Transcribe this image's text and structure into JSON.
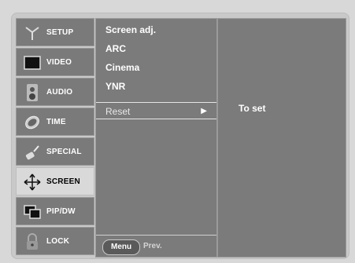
{
  "sidebar": {
    "items": [
      {
        "label": "SETUP",
        "icon": "antenna-icon",
        "selected": false
      },
      {
        "label": "VIDEO",
        "icon": "tv-icon",
        "selected": false
      },
      {
        "label": "AUDIO",
        "icon": "speaker-icon",
        "selected": false
      },
      {
        "label": "TIME",
        "icon": "clock-icon",
        "selected": false
      },
      {
        "label": "SPECIAL",
        "icon": "special-icon",
        "selected": false
      },
      {
        "label": "SCREEN",
        "icon": "move-arrows-icon",
        "selected": true
      },
      {
        "label": "PIP/DW",
        "icon": "pip-icon",
        "selected": false
      },
      {
        "label": "LOCK",
        "icon": "lock-icon",
        "selected": false
      }
    ]
  },
  "submenu": {
    "items": [
      "Screen adj.",
      "ARC",
      "Cinema",
      "YNR"
    ],
    "reset_label": "Reset",
    "reset_arrow": "▶"
  },
  "footer": {
    "menu_button": "Menu",
    "prev_label": "Prev."
  },
  "detail": {
    "text": "To set"
  },
  "colors": {
    "panel": "#7b7b7b",
    "selected": "#d9d9d9",
    "frame": "#c9c9c9"
  }
}
